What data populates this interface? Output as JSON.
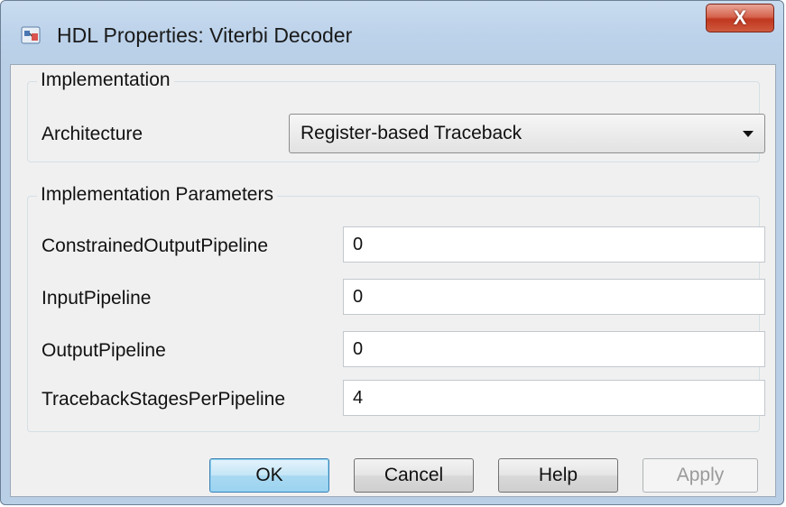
{
  "window": {
    "title": "HDL Properties: Viterbi Decoder",
    "close_label": "X"
  },
  "implementation": {
    "group_title": "Implementation",
    "architecture_label": "Architecture",
    "architecture_value": "Register-based Traceback"
  },
  "parameters": {
    "group_title": "Implementation Parameters",
    "rows": [
      {
        "label": "ConstrainedOutputPipeline",
        "value": "0"
      },
      {
        "label": "InputPipeline",
        "value": "0"
      },
      {
        "label": "OutputPipeline",
        "value": "0"
      },
      {
        "label": "TracebackStagesPerPipeline",
        "value": "4"
      }
    ]
  },
  "buttons": {
    "ok": "OK",
    "cancel": "Cancel",
    "help": "Help",
    "apply": "Apply"
  },
  "colors": {
    "titlebar": "#bcd2ea",
    "close_button": "#c94a32",
    "default_button": "#a9d9f2",
    "dialog_bg": "#f0f0f0"
  },
  "icons": {
    "app": "simulink-block-icon",
    "dropdown": "triangle-down-icon"
  }
}
